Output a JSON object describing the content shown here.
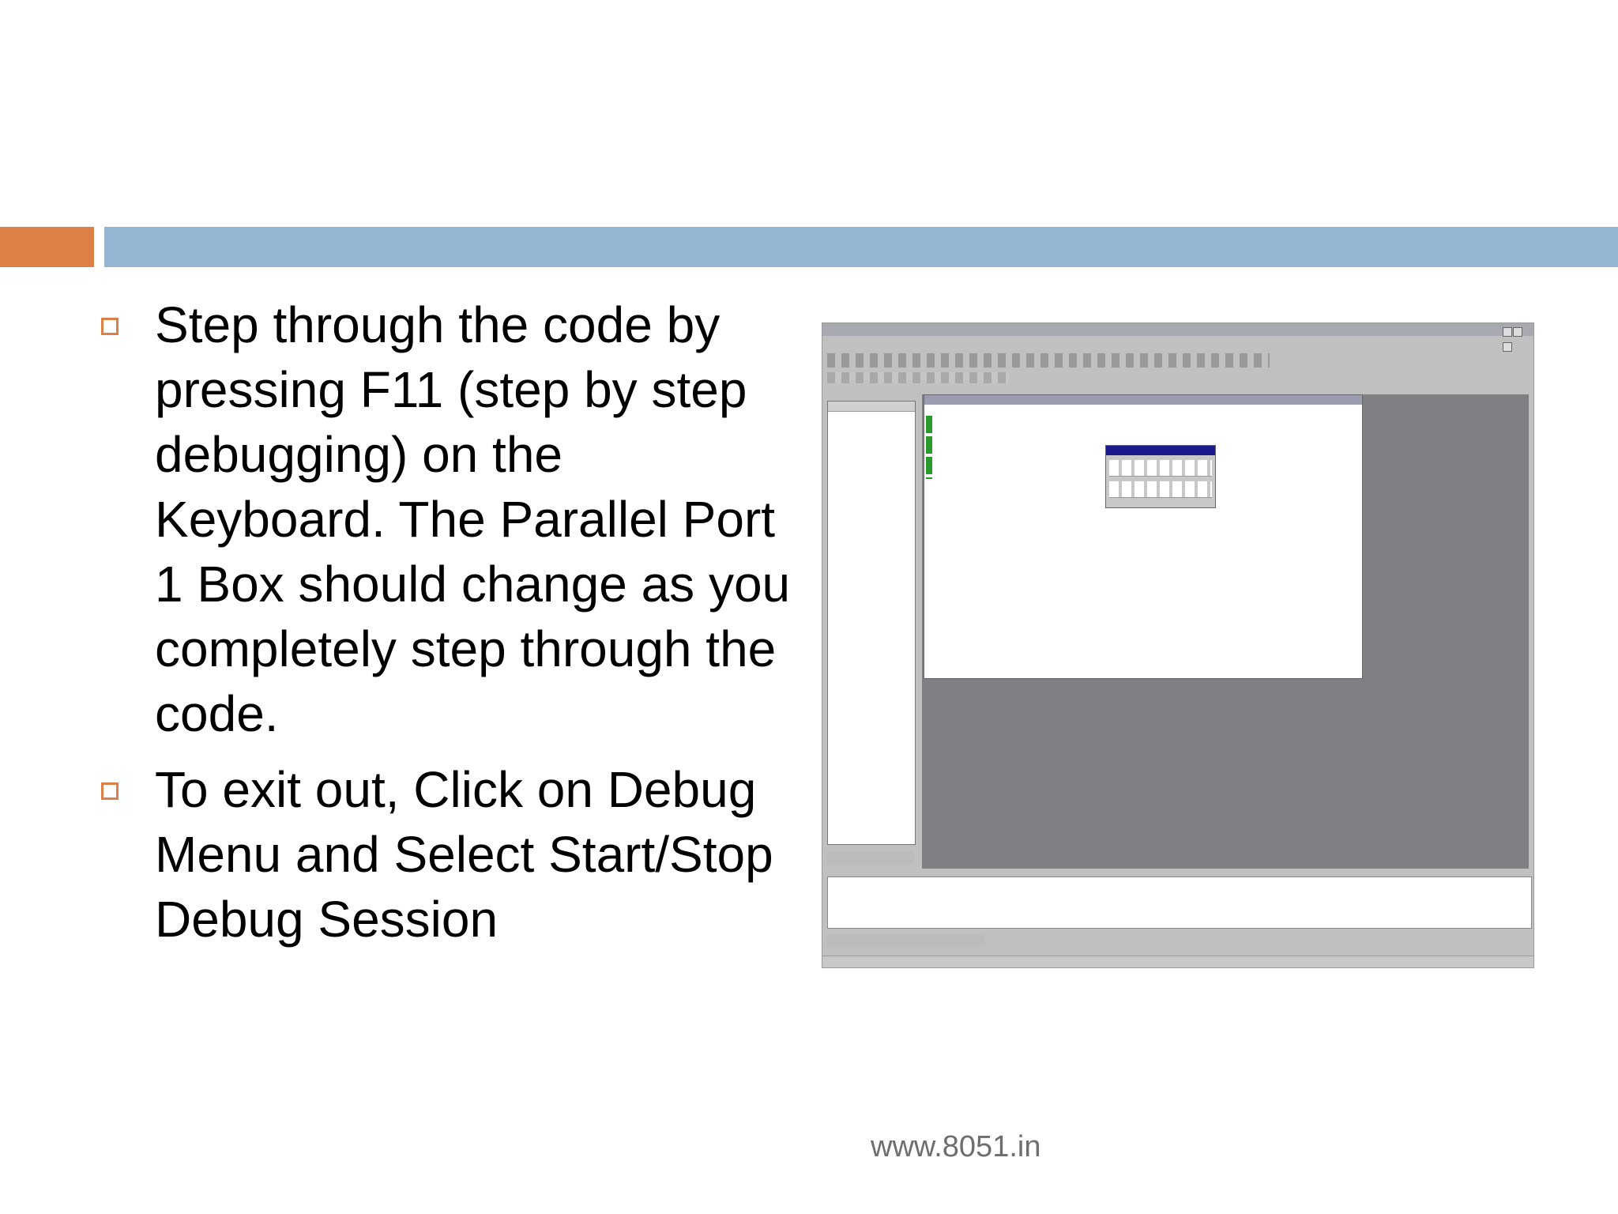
{
  "slide": {
    "bullets": [
      "Step through the code by pressing F11 (step by step debugging) on the Keyboard. The Parallel Port 1 Box should change as you completely step through the code.",
      "To exit out, Click on Debug Menu and Select Start/Stop Debug Session"
    ],
    "footer": "www.8051.in"
  },
  "colors": {
    "accent_orange": "#dd8047",
    "accent_blue": "#94b6d2"
  }
}
